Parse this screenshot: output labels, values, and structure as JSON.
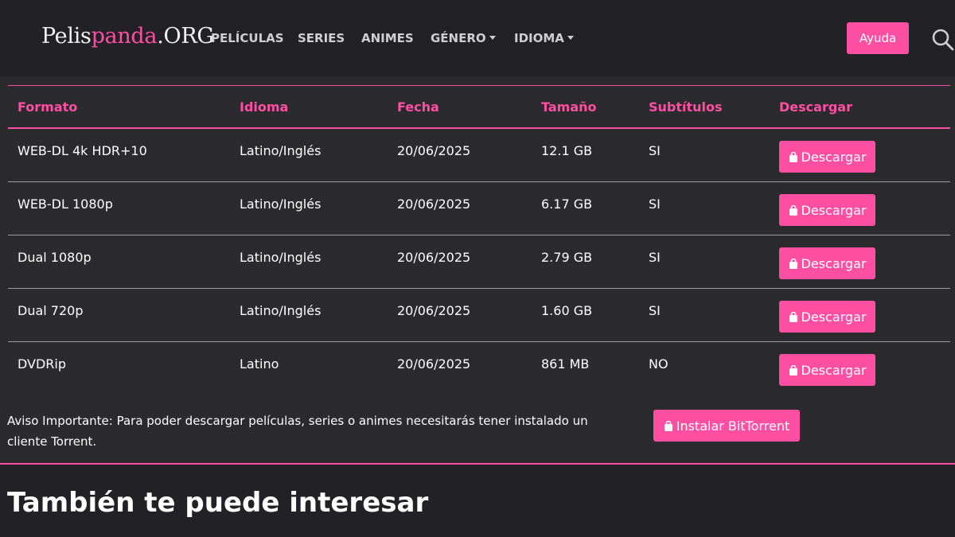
{
  "header": {
    "logo_part1": "Pelis",
    "logo_part2": "panda",
    "logo_part3": ".ORG",
    "nav": {
      "peliculas": "PELÍCULAS",
      "series": "SERIES",
      "animes": "ANIMES",
      "genero": "GÉNERO",
      "idioma": "IDIOMA"
    },
    "help_label": "Ayuda"
  },
  "table": {
    "headers": {
      "formato": "Formato",
      "idioma": "Idioma",
      "fecha": "Fecha",
      "tamano": "Tamaño",
      "subtitulos": "Subtítulos",
      "descargar": "Descargar"
    },
    "rows": [
      {
        "formato": "WEB-DL 4k HDR+10",
        "idioma": "Latino/Inglés",
        "fecha": "20/06/2025",
        "tamano": "12.1 GB",
        "subtitulos": "SI",
        "descargar": "Descargar"
      },
      {
        "formato": "WEB-DL 1080p",
        "idioma": "Latino/Inglés",
        "fecha": "20/06/2025",
        "tamano": "6.17 GB",
        "subtitulos": "SI",
        "descargar": "Descargar"
      },
      {
        "formato": "Dual 1080p",
        "idioma": "Latino/Inglés",
        "fecha": "20/06/2025",
        "tamano": "2.79 GB",
        "subtitulos": "SI",
        "descargar": "Descargar"
      },
      {
        "formato": "Dual 720p",
        "idioma": "Latino/Inglés",
        "fecha": "20/06/2025",
        "tamano": "1.60 GB",
        "subtitulos": "SI",
        "descargar": "Descargar"
      },
      {
        "formato": "DVDRip",
        "idioma": "Latino",
        "fecha": "20/06/2025",
        "tamano": "861 MB",
        "subtitulos": "NO",
        "descargar": "Descargar"
      }
    ]
  },
  "notice": {
    "text": "Aviso Importante: Para poder descargar películas, series o animes necesitarás tener instalado un cliente Torrent.",
    "button_label": "Instalar BitTorrent"
  },
  "related": {
    "title": "También te puede interesar"
  },
  "colors": {
    "accent": "#ff4fa3",
    "background": "#2b2a2f",
    "header_background": "#222126"
  },
  "icons": {
    "search": "search-icon",
    "download": "shopping-bag-icon"
  }
}
